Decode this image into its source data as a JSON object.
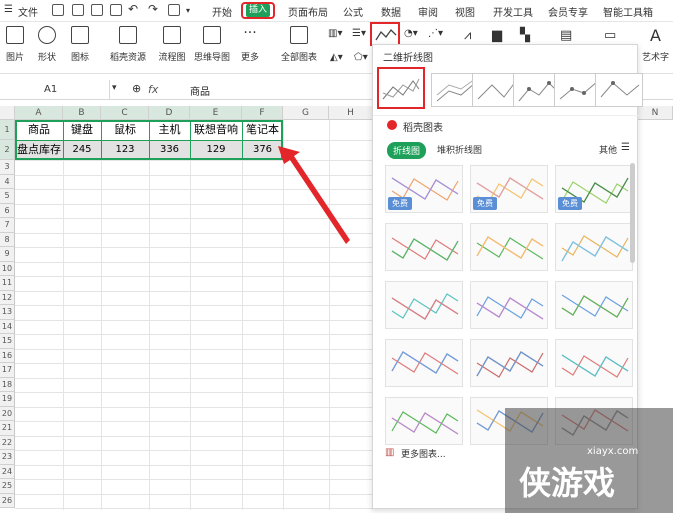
{
  "menubar": {
    "file": "文件",
    "tabs": [
      "开始",
      "插入",
      "页面布局",
      "公式",
      "数据",
      "审阅",
      "视图",
      "开发工具",
      "会员专享",
      "智能工具箱"
    ]
  },
  "ribbon": {
    "buttons": [
      "图片",
      "形状",
      "图标",
      "稻壳资源",
      "流程图",
      "思维导图",
      "更多",
      "全部图表"
    ],
    "art": "艺术字"
  },
  "formula": {
    "namebox": "A1",
    "fx": "fx",
    "value": "商品"
  },
  "sheet": {
    "columns": [
      "A",
      "B",
      "C",
      "D",
      "E",
      "F",
      "G",
      "H",
      "N"
    ],
    "rows": [
      "1",
      "2",
      "3",
      "4",
      "5",
      "6",
      "7",
      "8",
      "9",
      "10",
      "11",
      "12",
      "13",
      "14",
      "15",
      "16",
      "17",
      "18",
      "19",
      "20",
      "21",
      "22",
      "23",
      "24",
      "25",
      "26"
    ],
    "headers": [
      "商品",
      "键盘",
      "鼠标",
      "主机",
      "联想音响",
      "笔记本"
    ],
    "data": [
      "盘点库存",
      "245",
      "123",
      "336",
      "129",
      "376"
    ]
  },
  "panel": {
    "title": "二维折线图",
    "section": "稻壳图表",
    "tab_active": "折线图",
    "tab_other": "堆积折线图",
    "other": "其他",
    "free": "免费",
    "more": "更多图表...",
    "colors": {
      "accent": "#1fa05a",
      "red": "#e3262a",
      "free": "#5a8fd6"
    }
  },
  "watermark": {
    "site": "xiayx.com",
    "brand": "侠游戏"
  }
}
